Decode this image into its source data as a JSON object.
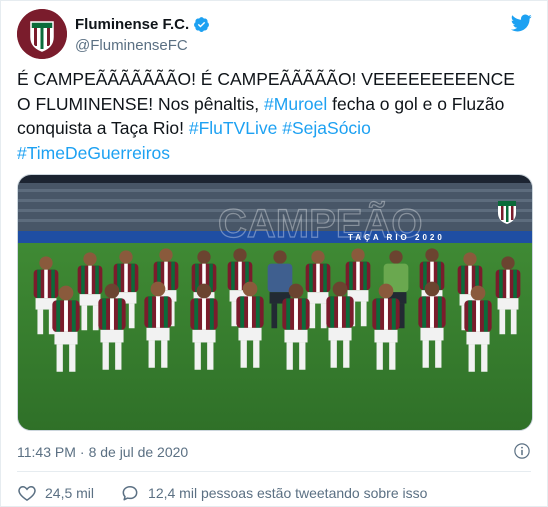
{
  "author": {
    "name": "Fluminense F.C.",
    "handle": "@FluminenseFC"
  },
  "tweet": {
    "text_main": "É CAMPEÃÃÃÃÃÃÃO! É CAMPEÃÃÃÃÃO! VEEEEEEEEENCE O FLUMINENSE! Nos pênaltis, ",
    "mention": "#Muroel",
    "text_mid": " fecha o gol e o Fluzão conquista a Taça Rio! ",
    "hashtag1": "#FluTVLive",
    "hashtag2": "#SejaSócio",
    "hashtag3": "#TimeDeGuerreiros"
  },
  "media": {
    "banner_text": "TAÇA RIO 2020",
    "watermark": "CAMPEÃO"
  },
  "meta": {
    "time": "11:43 PM",
    "separator": "·",
    "date": "8 de jul de 2020"
  },
  "actions": {
    "likes": "24,5 mil",
    "talking": "12,4 mil pessoas estão tweetando sobre isso"
  },
  "colors": {
    "link": "#1da1f2",
    "secondary": "#5b7083",
    "like_red": "#e0245e",
    "club_maroon": "#7a1c2c",
    "club_green": "#0b6b3a"
  }
}
